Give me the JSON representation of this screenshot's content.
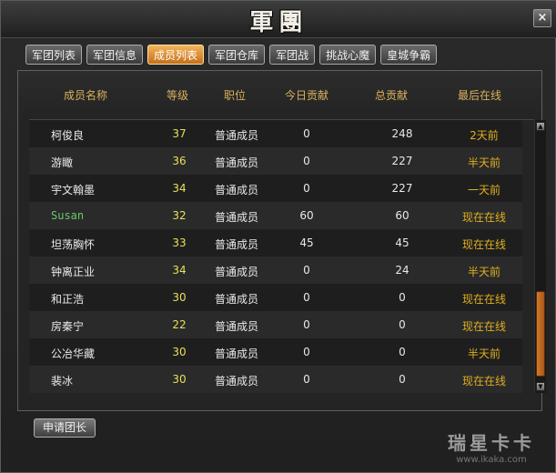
{
  "window": {
    "title": "軍團",
    "close_label": "×"
  },
  "tabs": [
    {
      "label": "军团列表",
      "active": false
    },
    {
      "label": "军团信息",
      "active": false
    },
    {
      "label": "成员列表",
      "active": true
    },
    {
      "label": "军团仓库",
      "active": false
    },
    {
      "label": "军团战",
      "active": false
    },
    {
      "label": "挑战心魔",
      "active": false
    },
    {
      "label": "皇城争霸",
      "active": false
    }
  ],
  "table": {
    "columns": [
      "成员名称",
      "等级",
      "职位",
      "今日贡献",
      "总贡献",
      "最后在线"
    ],
    "rows": [
      {
        "name": "柯俊良",
        "level": "37",
        "position": "普通成员",
        "today": "0",
        "total": "248",
        "last_online": "2天前"
      },
      {
        "name": "游瞰",
        "level": "36",
        "position": "普通成员",
        "today": "0",
        "total": "227",
        "last_online": "半天前"
      },
      {
        "name": "宇文翰墨",
        "level": "34",
        "position": "普通成员",
        "today": "0",
        "total": "227",
        "last_online": "一天前"
      },
      {
        "name": "Susan",
        "level": "32",
        "position": "普通成员",
        "today": "60",
        "total": "60",
        "last_online": "现在在线"
      },
      {
        "name": "坦荡胸怀",
        "level": "33",
        "position": "普通成员",
        "today": "45",
        "total": "45",
        "last_online": "现在在线"
      },
      {
        "name": "钟离正业",
        "level": "34",
        "position": "普通成员",
        "today": "0",
        "total": "24",
        "last_online": "半天前"
      },
      {
        "name": "和正浩",
        "level": "30",
        "position": "普通成员",
        "today": "0",
        "total": "0",
        "last_online": "现在在线"
      },
      {
        "name": "房秦宁",
        "level": "22",
        "position": "普通成员",
        "today": "0",
        "total": "0",
        "last_online": "现在在线"
      },
      {
        "name": "公冶华藏",
        "level": "30",
        "position": "普通成员",
        "today": "0",
        "total": "0",
        "last_online": "半天前"
      },
      {
        "name": "裴冰",
        "level": "30",
        "position": "普通成员",
        "today": "0",
        "total": "0",
        "last_online": "现在在线"
      }
    ]
  },
  "scrollbar": {
    "up_label": "▲",
    "down_label": "▼"
  },
  "buttons": {
    "apply_leader": "申请团长"
  },
  "watermark": {
    "main": "瑞星卡卡",
    "sub": "www.ikaka.com"
  }
}
